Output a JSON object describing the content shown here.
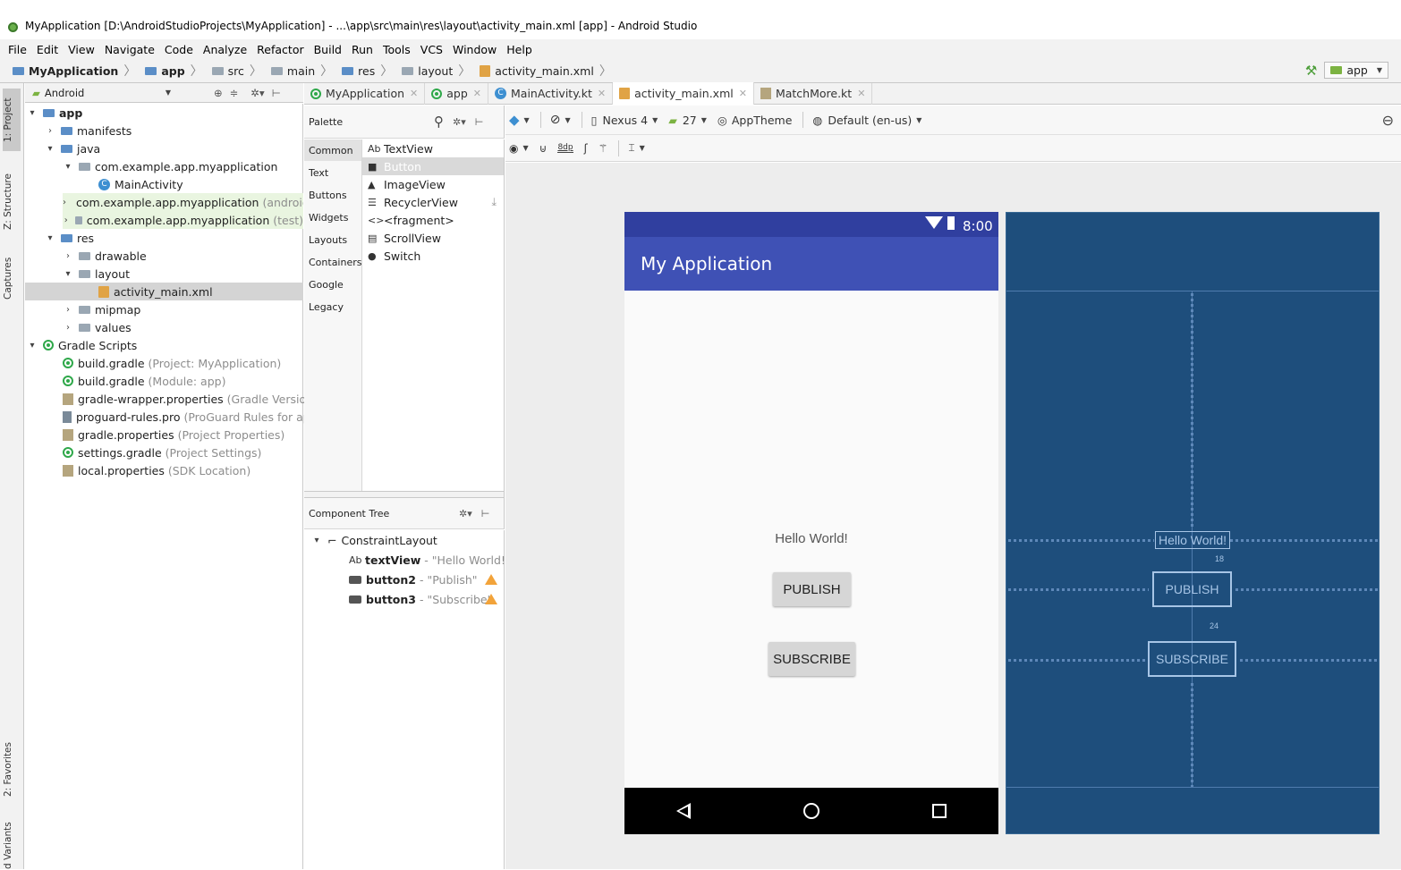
{
  "window": {
    "title": "MyApplication [D:\\AndroidStudioProjects\\MyApplication] - ...\\app\\src\\main\\res\\layout\\activity_main.xml [app] - Android Studio"
  },
  "menu": [
    "File",
    "Edit",
    "View",
    "Navigate",
    "Code",
    "Analyze",
    "Refactor",
    "Build",
    "Run",
    "Tools",
    "VCS",
    "Window",
    "Help"
  ],
  "breadcrumb": [
    "MyApplication",
    "app",
    "src",
    "main",
    "res",
    "layout",
    "activity_main.xml"
  ],
  "run_config": "app",
  "left_strip": {
    "project": "1: Project",
    "structure": "Z: Structure",
    "captures": "Captures",
    "favorites": "2: Favorites",
    "variants": "d Variants"
  },
  "project_panel": {
    "view_mode": "Android",
    "tree": [
      {
        "label": "app",
        "bold": true
      },
      {
        "label": "manifests"
      },
      {
        "label": "java"
      },
      {
        "label": "com.example.app.myapplication"
      },
      {
        "label": "MainActivity"
      },
      {
        "label": "com.example.app.myapplication",
        "suffix": "(androidTe"
      },
      {
        "label": "com.example.app.myapplication",
        "suffix": "(test)"
      },
      {
        "label": "res"
      },
      {
        "label": "drawable"
      },
      {
        "label": "layout"
      },
      {
        "label": "activity_main.xml"
      },
      {
        "label": "mipmap"
      },
      {
        "label": "values"
      },
      {
        "label": "Gradle Scripts"
      },
      {
        "label": "build.gradle",
        "suffix": "(Project: MyApplication)"
      },
      {
        "label": "build.gradle",
        "suffix": "(Module: app)"
      },
      {
        "label": "gradle-wrapper.properties",
        "suffix": "(Gradle Version)"
      },
      {
        "label": "proguard-rules.pro",
        "suffix": "(ProGuard Rules for app)"
      },
      {
        "label": "gradle.properties",
        "suffix": "(Project Properties)"
      },
      {
        "label": "settings.gradle",
        "suffix": "(Project Settings)"
      },
      {
        "label": "local.properties",
        "suffix": "(SDK Location)"
      }
    ]
  },
  "editor_tabs": [
    "MyApplication",
    "app",
    "MainActivity.kt",
    "activity_main.xml",
    "MatchMore.kt"
  ],
  "palette": {
    "title": "Palette",
    "categories": [
      "Common",
      "Text",
      "Buttons",
      "Widgets",
      "Layouts",
      "Containers",
      "Google",
      "Legacy"
    ],
    "items": [
      {
        "icon": "Ab",
        "label": "TextView"
      },
      {
        "icon": "■",
        "label": "Button"
      },
      {
        "icon": "▲",
        "label": "ImageView"
      },
      {
        "icon": "☰",
        "label": "RecyclerView"
      },
      {
        "icon": "<>",
        "label": "<fragment>"
      },
      {
        "icon": "▤",
        "label": "ScrollView"
      },
      {
        "icon": "●",
        "label": "Switch"
      }
    ]
  },
  "component_tree": {
    "title": "Component Tree",
    "root": "ConstraintLayout",
    "children": [
      {
        "icon": "Ab",
        "id": "textView",
        "desc": "- \"Hello World!\""
      },
      {
        "icon": "btn",
        "id": "button2",
        "desc": "- \"Publish\""
      },
      {
        "icon": "btn",
        "id": "button3",
        "desc": "- \"Subscribe\""
      }
    ]
  },
  "design_toolbar": {
    "device": "Nexus 4",
    "api": "27",
    "theme": "AppTheme",
    "locale": "Default (en-us)",
    "margin": "8dp"
  },
  "preview": {
    "time": "8:00",
    "app_title": "My Application",
    "text": "Hello World!",
    "button1": "PUBLISH",
    "button2": "SUBSCRIBE",
    "bp_text": "Hello World!",
    "bp_button1": "PUBLISH",
    "bp_button2": "SUBSCRIBE",
    "margin_top": "18",
    "margin_mid": "24"
  },
  "colors": {
    "primary": "#3f51b5",
    "primary_dark": "#303f9f",
    "blueprint": "#1e4e7c",
    "warning": "#f2a33a"
  }
}
